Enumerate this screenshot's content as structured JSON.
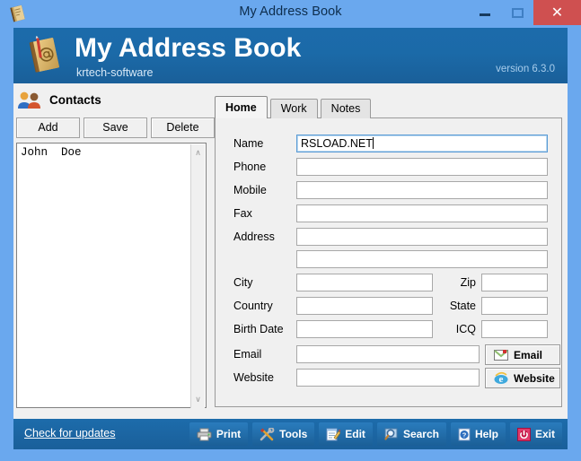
{
  "window": {
    "title": "My Address Book",
    "icon": "address-book-icon",
    "buttons": {
      "minimize": "–",
      "maximize": "❑",
      "close": "✕"
    }
  },
  "banner": {
    "title": "My Address Book",
    "subtitle": "krtech-software",
    "version": "version 6.3.0",
    "logo": "address-book-logo",
    "bg_color": "#1c6bab"
  },
  "sidebar": {
    "heading": "Contacts",
    "heading_icon": "contacts-people-icon",
    "buttons": [
      {
        "label": "Add",
        "name": "add-contact-button"
      },
      {
        "label": "Save",
        "name": "save-contact-button"
      },
      {
        "label": "Delete",
        "name": "delete-contact-button"
      }
    ],
    "list": [
      "John  Doe"
    ],
    "scrollbar": {
      "up": "∧",
      "down": "∨"
    }
  },
  "tabs": [
    {
      "label": "Home",
      "active": true
    },
    {
      "label": "Work",
      "active": false
    },
    {
      "label": "Notes",
      "active": false
    }
  ],
  "form": {
    "fields": [
      {
        "label": "Name",
        "value": "RSLOAD.NET",
        "focused": true
      },
      {
        "label": "Phone",
        "value": ""
      },
      {
        "label": "Mobile",
        "value": ""
      },
      {
        "label": "Fax",
        "value": ""
      },
      {
        "label": "Address",
        "value": ""
      },
      {
        "label": "",
        "value": ""
      }
    ],
    "pairs": [
      {
        "label": "City",
        "value": "",
        "label2": "Zip",
        "value2": ""
      },
      {
        "label": "Country",
        "value": "",
        "label2": "State",
        "value2": ""
      },
      {
        "label": "Birth Date",
        "value": "",
        "label2": "ICQ",
        "value2": ""
      }
    ],
    "email": {
      "label": "Email",
      "value": "",
      "button": "Email",
      "icon": "envelope-icon"
    },
    "website": {
      "label": "Website",
      "value": "",
      "button": "Website",
      "icon": "browser-e-icon"
    }
  },
  "bottom": {
    "update_link": "Check for updates",
    "tools": [
      {
        "label": "Print",
        "icon": "printer-icon"
      },
      {
        "label": "Tools",
        "icon": "wrench-screwdriver-icon"
      },
      {
        "label": "Edit",
        "icon": "notepad-pencil-icon"
      },
      {
        "label": "Search",
        "icon": "magnifier-icon"
      },
      {
        "label": "Help",
        "icon": "help-question-icon"
      },
      {
        "label": "Exit",
        "icon": "power-icon"
      }
    ]
  }
}
